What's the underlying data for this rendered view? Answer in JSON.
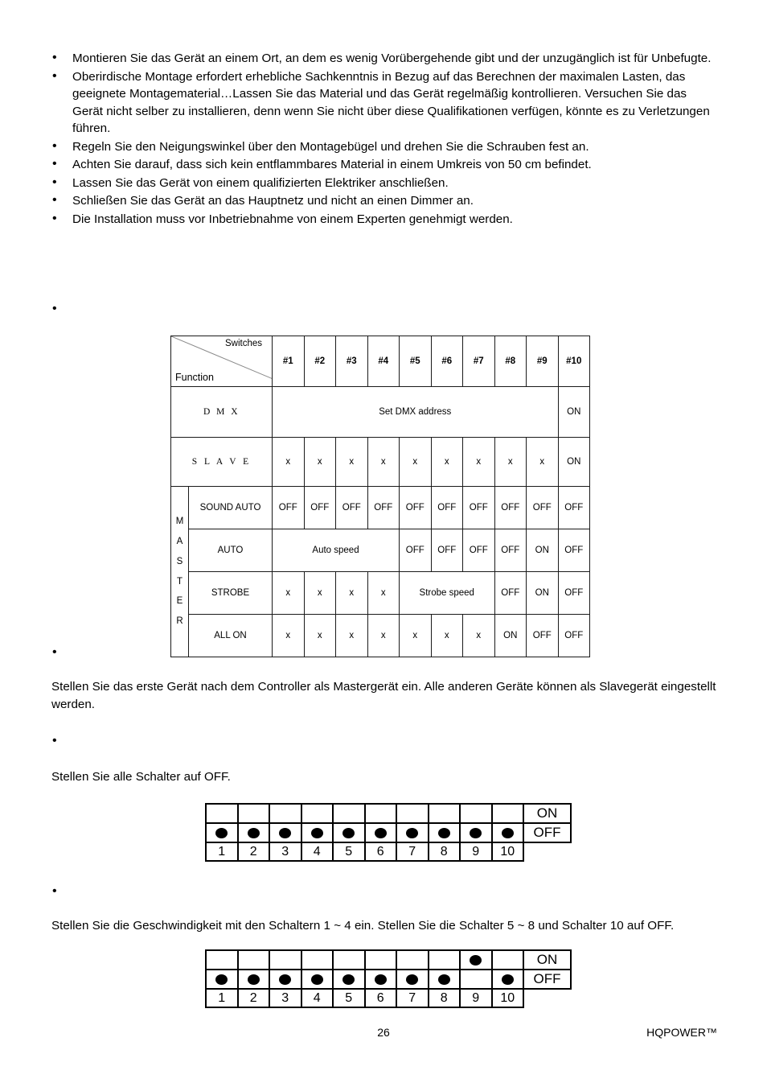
{
  "bullets": [
    "Montieren Sie das Gerät an einem Ort, an dem es wenig Vorübergehende gibt und der unzugänglich ist für Unbefugte.",
    "Oberirdische Montage erfordert erhebliche Sachkenntnis in Bezug auf das Berechnen der maximalen Lasten, das geeignete Montagematerial…Lassen Sie das Material und das Gerät regelmäßig kontrollieren. Versuchen Sie das Gerät nicht selber zu installieren, denn wenn Sie nicht über diese Qualifikationen verfügen, könnte es zu Verletzungen führen.",
    "Regeln Sie den Neigungswinkel über den Montagebügel und drehen Sie die Schrauben fest an.",
    "Achten Sie darauf, dass sich kein entflammbares Material in einem Umkreis von 50 cm befindet.",
    "Lassen Sie das Gerät von einem qualifizierten Elektriker anschließen.",
    "Schließen Sie das Gerät an das Hauptnetz und nicht an einen Dimmer an.",
    "Die Installation muss vor Inbetriebnahme von einem Experten genehmigt werden."
  ],
  "dmx_table": {
    "corner": {
      "switches_label": "Switches",
      "function_label": "Function"
    },
    "switch_headers": [
      "#1",
      "#2",
      "#3",
      "#4",
      "#5",
      "#6",
      "#7",
      "#8",
      "#9",
      "#10"
    ],
    "rows": {
      "dmx": {
        "label": "D M X",
        "span_text": "Set DMX address",
        "span_cols": 9,
        "last": "ON"
      },
      "slave": {
        "label": "S L A V E",
        "values": [
          "x",
          "x",
          "x",
          "x",
          "x",
          "x",
          "x",
          "x",
          "x",
          "ON"
        ]
      },
      "master_label": "MASTER",
      "sound_auto": {
        "label": "SOUND AUTO",
        "values": [
          "OFF",
          "OFF",
          "OFF",
          "OFF",
          "OFF",
          "OFF",
          "OFF",
          "OFF",
          "OFF",
          "OFF"
        ]
      },
      "auto": {
        "label": "AUTO",
        "span_text": "Auto speed",
        "span_cols": 4,
        "values": [
          "OFF",
          "OFF",
          "OFF",
          "OFF",
          "ON",
          "OFF"
        ]
      },
      "strobe": {
        "label": "STROBE",
        "pre_values": [
          "x",
          "x",
          "x",
          "x"
        ],
        "span_text": "Strobe speed",
        "span_cols": 3,
        "values": [
          "OFF",
          "ON",
          "OFF"
        ]
      },
      "all_on": {
        "label": "ALL ON",
        "values": [
          "x",
          "x",
          "x",
          "x",
          "x",
          "x",
          "x",
          "ON",
          "OFF",
          "OFF"
        ]
      }
    }
  },
  "paragraphs": {
    "master_slave": "Stellen Sie das erste Gerät nach dem Controller als Mastergerät ein. Alle anderen Geräte können als Slavegerät eingestellt werden.",
    "all_off": "Stellen Sie alle Schalter auf OFF.",
    "speed": "Stellen Sie die Geschwindigkeit mit den Schaltern 1 ~ 4 ein. Stellen Sie die Schalter 5 ~ 8 und Schalter 10 auf OFF."
  },
  "dip_diagrams": [
    {
      "on_label": "ON",
      "off_label": "OFF",
      "numbers": [
        "1",
        "2",
        "3",
        "4",
        "5",
        "6",
        "7",
        "8",
        "9",
        "10"
      ],
      "positions": [
        "OFF",
        "OFF",
        "OFF",
        "OFF",
        "OFF",
        "OFF",
        "OFF",
        "OFF",
        "OFF",
        "OFF"
      ]
    },
    {
      "on_label": "ON",
      "off_label": "OFF",
      "numbers": [
        "1",
        "2",
        "3",
        "4",
        "5",
        "6",
        "7",
        "8",
        "9",
        "10"
      ],
      "positions": [
        "OFF",
        "OFF",
        "OFF",
        "OFF",
        "OFF",
        "OFF",
        "OFF",
        "OFF",
        "ON",
        "OFF"
      ]
    }
  ],
  "footer": {
    "page_number": "26",
    "brand": "HQPOWER™"
  }
}
